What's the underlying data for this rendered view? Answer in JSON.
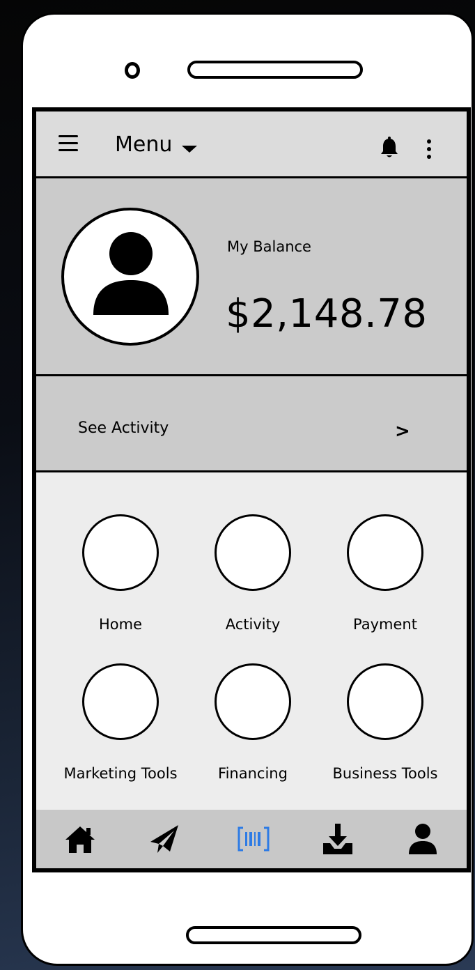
{
  "topbar": {
    "menu_label": "Menu",
    "icons": [
      "hamburger-icon",
      "caret-down-icon",
      "bell-icon",
      "kebab-icon"
    ]
  },
  "balance": {
    "label": "My Balance",
    "amount": "$2,148.78"
  },
  "activity": {
    "label": "See Activity",
    "chevron": ">"
  },
  "grid": {
    "items": [
      {
        "label": "Home"
      },
      {
        "label": "Activity"
      },
      {
        "label": "Payment"
      },
      {
        "label": "Marketing Tools"
      },
      {
        "label": "Financing"
      },
      {
        "label": "Business Tools"
      }
    ]
  },
  "tabbar": {
    "icons": [
      "home-icon",
      "send-icon",
      "barcode-icon",
      "download-icon",
      "user-icon"
    ],
    "active_color": "#2d7be5"
  }
}
